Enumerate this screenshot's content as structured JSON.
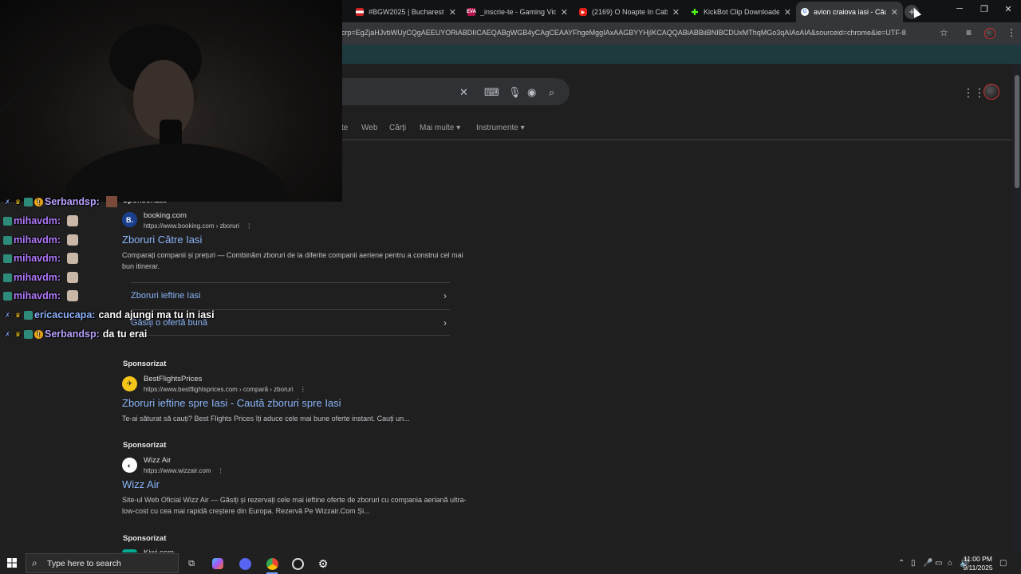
{
  "tabs": [
    {
      "label": "#BGW2025 | Bucharest G",
      "favicon": "bgw-flag-icon",
      "active": false
    },
    {
      "label": "_inscrie-te - Gaming Vide",
      "favicon": "eva-icon",
      "active": false
    },
    {
      "label": "(2169) O Noapte In Caba",
      "favicon": "youtube-icon",
      "active": false
    },
    {
      "label": "KickBot Clip Downloader",
      "favicon": "kickbot-icon",
      "active": false
    },
    {
      "label": "avion craiova iasi - Căuta",
      "favicon": "google-icon",
      "active": true
    }
  ],
  "new_tab_label": "+",
  "address_bar": {
    "url": "crp=EgZjaHJvbWUyCQgAEEUYORiABDIICAEQABgWGB4yCAgCEAAYFhgeMggIAxAAGBYYHjIKCAQQABiABBiiBNIBCDUxMThqMGo3qAIAsAIA&sourceid=chrome&ie=UTF-8"
  },
  "google": {
    "search_tabs": [
      "te",
      "Web",
      "Cărți",
      "Mai multe",
      "Instrumente"
    ],
    "results": [
      {
        "sponsored": "Sponsorizat",
        "site": "booking.com",
        "url": "https://www.booking.com › zboruri",
        "logo_text": "B.",
        "title": "Zboruri Către Iasi",
        "desc": "Comparați companii și prețuri — Combinăm zboruri de la diferite companii aeriene pentru a construi cel mai bun itinerar.",
        "sitelinks": [
          "Zboruri ieftine Iasi",
          "Găsiți o ofertă bună"
        ]
      },
      {
        "sponsored": "Sponsorizat",
        "site": "BestFlightsPrices",
        "url": "https://www.bestflightsprices.com › compară › zboruri",
        "logo_text": "",
        "title": "Zboruri ieftine spre Iasi - Caută zboruri spre Iasi",
        "desc": "Te-ai săturat să cauți? Best Flights Prices îți aduce cele mai bune oferte instant. Cauți un..."
      },
      {
        "sponsored": "Sponsorizat",
        "site": "Wizz Air",
        "url": "https://www.wizzair.com",
        "logo_text": "",
        "title": "Wizz Air",
        "desc": "Site-ul Web Oficial Wizz Air — Găsiți și rezervați cele mai ieftine oferte de zboruri cu compania aeriană ultra-low-cost cu cea mai rapidă creștere din Europa. Rezervă Pe Wizzair.Com Și..."
      },
      {
        "sponsored": "Sponsorizat",
        "site": "Kiwi.com"
      }
    ]
  },
  "chat": [
    {
      "user": "Serbandsp:",
      "msg": "",
      "color": "#b9a2ff"
    },
    {
      "user": "mihavdm:",
      "msg": "",
      "color": "#b27bff"
    },
    {
      "user": "mihavdm:",
      "msg": "",
      "color": "#b27bff"
    },
    {
      "user": "mihavdm:",
      "msg": "",
      "color": "#b27bff"
    },
    {
      "user": "mihavdm:",
      "msg": "",
      "color": "#b27bff"
    },
    {
      "user": "mihavdm:",
      "msg": "",
      "color": "#b27bff"
    },
    {
      "user": "ericacucapa:",
      "msg": "cand ajungi ma tu in iasi",
      "color": "#8fb3ff"
    },
    {
      "user": "Serbandsp:",
      "msg": "da tu erai",
      "color": "#b9a2ff"
    }
  ],
  "taskbar": {
    "search_placeholder": "Type here to search",
    "time": "11:00 PM",
    "date": "9/11/2025"
  }
}
